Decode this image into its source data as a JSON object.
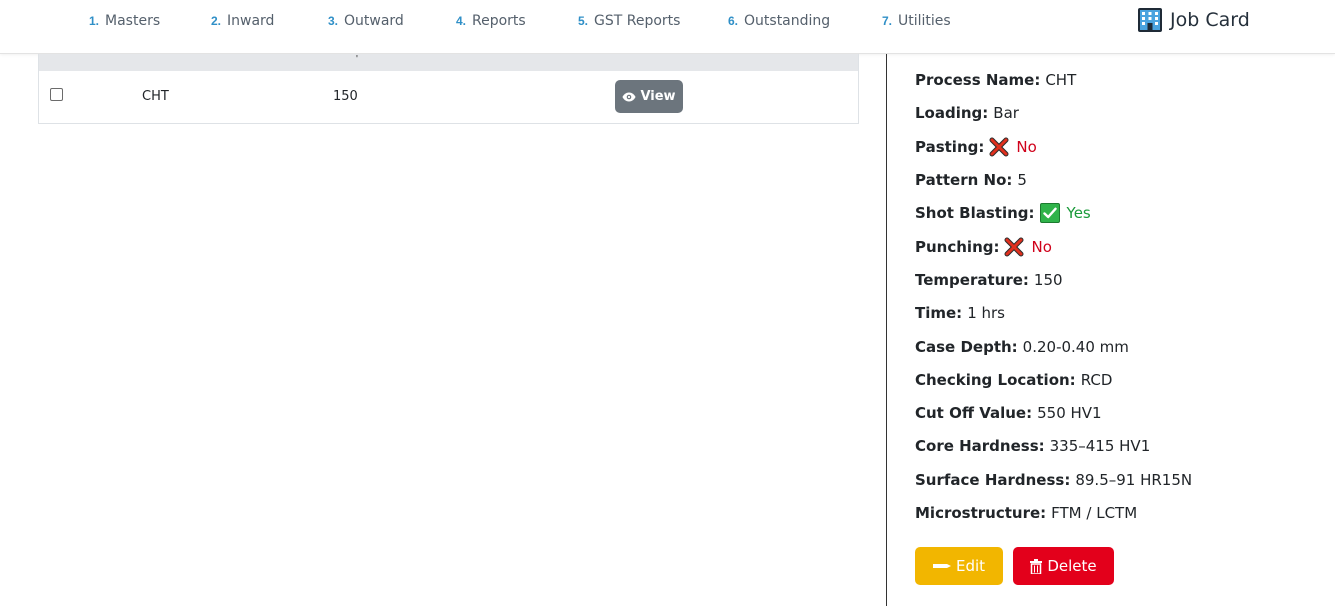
{
  "nav": {
    "items": [
      {
        "num": "1.",
        "label": "Masters"
      },
      {
        "num": "2.",
        "label": "Inward"
      },
      {
        "num": "3.",
        "label": "Outward"
      },
      {
        "num": "4.",
        "label": "Reports"
      },
      {
        "num": "5.",
        "label": "GST Reports"
      },
      {
        "num": "6.",
        "label": "Outstanding"
      },
      {
        "num": "7.",
        "label": "Utilities"
      }
    ],
    "brand_title": "Job Card",
    "brand_icon": "building-icon"
  },
  "table": {
    "header_fragment": "'",
    "rows": [
      {
        "process": "CHT",
        "temperature": "150",
        "view_label": "View"
      }
    ]
  },
  "detail": {
    "process_name": {
      "label": "Process Name:",
      "value": "CHT"
    },
    "loading": {
      "label": "Loading:",
      "value": "Bar"
    },
    "pasting": {
      "label": "Pasting:",
      "value": "No"
    },
    "pattern_no": {
      "label": "Pattern No:",
      "value": "5"
    },
    "shot_blasting": {
      "label": "Shot Blasting:",
      "value": "Yes"
    },
    "punching": {
      "label": "Punching:",
      "value": "No"
    },
    "temperature": {
      "label": "Temperature:",
      "value": "150"
    },
    "time": {
      "label": "Time:",
      "value": "1 hrs"
    },
    "case_depth": {
      "label": "Case Depth:",
      "value": "0.20-0.40 mm"
    },
    "checking_location": {
      "label": "Checking Location:",
      "value": "RCD"
    },
    "cut_off_value": {
      "label": "Cut Off Value:",
      "value": "550 HV1"
    },
    "core_hardness": {
      "label": "Core Hardness:",
      "value": "335–415 HV1"
    },
    "surface_hardness": {
      "label": "Surface Hardness:",
      "value": "89.5–91 HR15N"
    },
    "microstructure": {
      "label": "Microstructure:",
      "value": "FTM / LCTM"
    }
  },
  "actions": {
    "edit_label": "Edit",
    "delete_label": "Delete"
  },
  "colors": {
    "nav_number": "#2f8fc7",
    "view_button": "#6c757d",
    "edit_button": "#f2b600",
    "delete_button": "#e3001b",
    "status_no": "#d0021b",
    "status_yes": "#1a9a3a"
  }
}
